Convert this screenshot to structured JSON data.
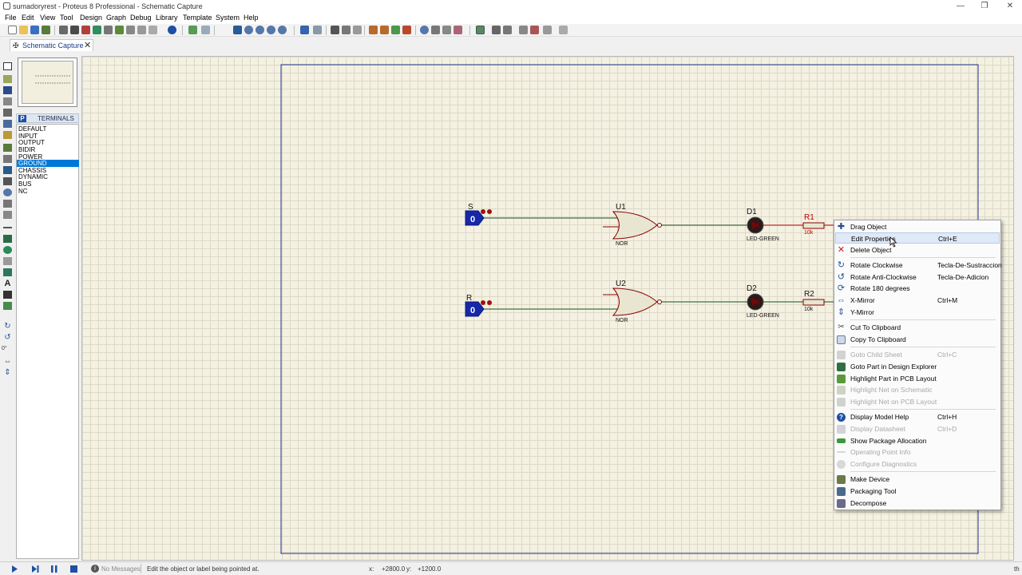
{
  "window": {
    "title": "sumadoryrest - Proteus 8 Professional - Schematic Capture",
    "minimize": "—",
    "maximize": "❐",
    "close": "✕"
  },
  "menu": [
    "File",
    "Edit",
    "View",
    "Tool",
    "Design",
    "Graph",
    "Debug",
    "Library",
    "Template",
    "System",
    "Help"
  ],
  "tab": {
    "label": "Schematic Capture",
    "close": "✕"
  },
  "terminals": {
    "badge": "P",
    "title": "TERMINALS",
    "items": [
      "DEFAULT",
      "INPUT",
      "OUTPUT",
      "BIDIR",
      "POWER",
      "GROUND",
      "CHASSIS",
      "DYNAMIC",
      "BUS",
      "NC"
    ],
    "selected": "GROUND"
  },
  "left_tools": {
    "rotation": "0°"
  },
  "schematic": {
    "in1": {
      "name": "S",
      "value": "0"
    },
    "in2": {
      "name": "R",
      "value": "0"
    },
    "gate1": {
      "ref": "U1",
      "type": "NOR"
    },
    "gate2": {
      "ref": "U2",
      "type": "NOR"
    },
    "led1": {
      "ref": "D1",
      "type": "LED-GREEN"
    },
    "led2": {
      "ref": "D2",
      "type": "LED-GREEN"
    },
    "res1": {
      "ref": "R1",
      "value": "10k"
    },
    "res2": {
      "ref": "R2",
      "value": "10k"
    }
  },
  "context_menu": {
    "items": [
      {
        "label": "Drag Object",
        "shortcut": "",
        "icon": "move-cross-icon",
        "enabled": true
      },
      {
        "label": "Edit Properties",
        "shortcut": "Ctrl+E",
        "icon": "",
        "enabled": true,
        "highlighted": true
      },
      {
        "label": "Delete Object",
        "shortcut": "",
        "icon": "delete-x-icon",
        "enabled": true
      },
      {
        "label": "Rotate Clockwise",
        "shortcut": "Tecla-De-Sustraccion",
        "icon": "rotate-cw-icon",
        "enabled": true
      },
      {
        "label": "Rotate Anti-Clockwise",
        "shortcut": "Tecla-De-Adicion",
        "icon": "rotate-ccw-icon",
        "enabled": true
      },
      {
        "label": "Rotate 180 degrees",
        "shortcut": "",
        "icon": "rotate-180-icon",
        "enabled": true
      },
      {
        "label": "X-Mirror",
        "shortcut": "Ctrl+M",
        "icon": "x-mirror-icon",
        "enabled": true
      },
      {
        "label": "Y-Mirror",
        "shortcut": "",
        "icon": "y-mirror-icon",
        "enabled": true
      },
      {
        "label": "Cut To Clipboard",
        "shortcut": "",
        "icon": "scissors-icon",
        "enabled": true
      },
      {
        "label": "Copy To Clipboard",
        "shortcut": "",
        "icon": "copy-icon",
        "enabled": true
      },
      {
        "label": "Goto Child Sheet",
        "shortcut": "Ctrl+C",
        "icon": "child-sheet-icon",
        "enabled": false
      },
      {
        "label": "Goto Part in Design Explorer",
        "shortcut": "",
        "icon": "design-explorer-icon",
        "enabled": true
      },
      {
        "label": "Highlight Part in PCB Layout",
        "shortcut": "",
        "icon": "pcb-highlight-icon",
        "enabled": true
      },
      {
        "label": "Highlight Net on Schematic",
        "shortcut": "",
        "icon": "net-schematic-icon",
        "enabled": false
      },
      {
        "label": "Highlight Net on PCB Layout",
        "shortcut": "",
        "icon": "net-pcb-icon",
        "enabled": false
      },
      {
        "label": "Display Model Help",
        "shortcut": "Ctrl+H",
        "icon": "help-icon",
        "enabled": true
      },
      {
        "label": "Display Datasheet",
        "shortcut": "Ctrl+D",
        "icon": "datasheet-icon",
        "enabled": false
      },
      {
        "label": "Show Package Allocation",
        "shortcut": "",
        "icon": "package-icon",
        "enabled": true
      },
      {
        "label": "Operating Point Info",
        "shortcut": "",
        "icon": "probe-icon",
        "enabled": false
      },
      {
        "label": "Configure Diagnostics",
        "shortcut": "",
        "icon": "diagnostics-icon",
        "enabled": false
      },
      {
        "label": "Make Device",
        "shortcut": "",
        "icon": "make-device-icon",
        "enabled": true
      },
      {
        "label": "Packaging Tool",
        "shortcut": "",
        "icon": "packaging-tool-icon",
        "enabled": true
      },
      {
        "label": "Decompose",
        "shortcut": "",
        "icon": "decompose-icon",
        "enabled": true
      }
    ]
  },
  "status": {
    "messages": "No Messages",
    "hint": "Edit the object or label being pointed at.",
    "x_label": "x:",
    "x_value": "+2800.0",
    "y_label": "y:",
    "y_value": "+1200.0",
    "edge": "th"
  },
  "colors": {
    "canvas_bg": "#f4f1e2",
    "grid": "#dcd9c6",
    "sheet_border": "#1f2f8f",
    "wire_green": "#1a4d1a",
    "wire_red": "#c00000",
    "terminal_blue": "#1428a8",
    "gate_fill": "#e8e6d0",
    "gate_outline": "#8b0000",
    "selection": "#0078d7"
  }
}
